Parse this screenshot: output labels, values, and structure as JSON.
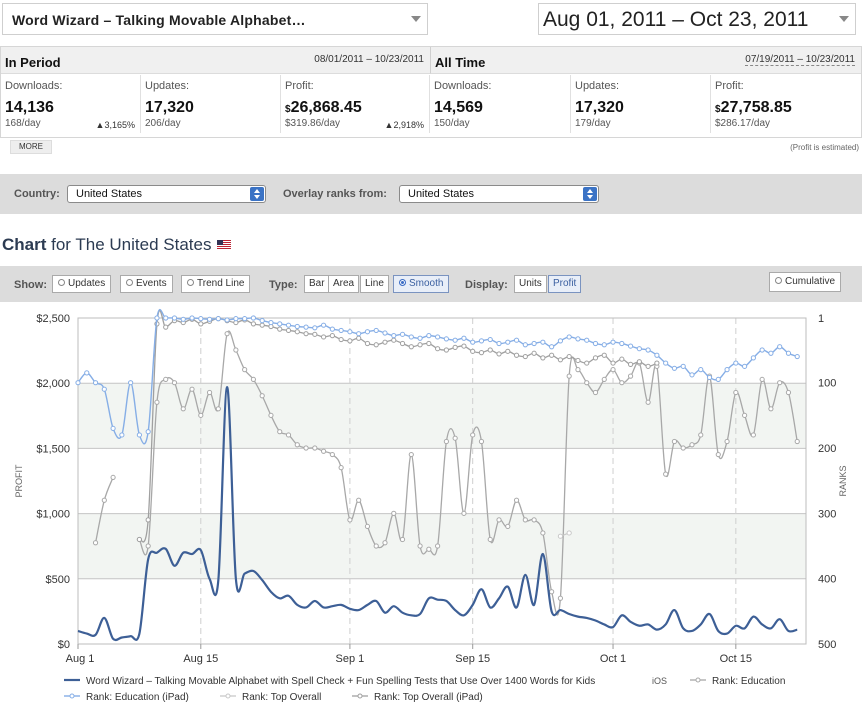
{
  "top": {
    "app_name": "Word Wizard – Talking Movable Alphabet…",
    "date_range": "Aug 01, 2011 – Oct 23, 2011"
  },
  "in_period": {
    "title": "In Period",
    "range": "08/01/2011 – 10/23/2011",
    "downloads": {
      "label": "Downloads:",
      "value": "14,136",
      "per_day": "168/day",
      "change": "3,165%"
    },
    "updates": {
      "label": "Updates:",
      "value": "17,320",
      "per_day": "206/day"
    },
    "profit": {
      "label": "Profit:",
      "currency": "$",
      "value": "26,868.45",
      "per_day": "$319.86/day",
      "change": "2,918%"
    }
  },
  "all_time": {
    "title": "All Time",
    "range": "07/19/2011 – 10/23/2011",
    "downloads": {
      "label": "Downloads:",
      "value": "14,569",
      "per_day": "150/day"
    },
    "updates": {
      "label": "Updates:",
      "value": "17,320",
      "per_day": "179/day"
    },
    "profit": {
      "label": "Profit:",
      "currency": "$",
      "value": "27,758.85",
      "per_day": "$286.17/day"
    }
  },
  "more_label": "MORE",
  "profit_note": "(Profit is estimated)",
  "filters": {
    "country_label": "Country:",
    "country_value": "United States",
    "overlay_label": "Overlay ranks from:",
    "overlay_value": "United States"
  },
  "chart_heading": {
    "bold": "Chart",
    "rest": " for The United States"
  },
  "toolbar": {
    "show_label": "Show:",
    "updates": "Updates",
    "events": "Events",
    "trend_line": "Trend Line",
    "type_label": "Type:",
    "bar": "Bar",
    "area": "Area",
    "line": "Line",
    "smooth": "Smooth",
    "display_label": "Display:",
    "units": "Units",
    "profit": "Profit",
    "cumulative": "Cumulative"
  },
  "colors": {
    "profit_line": "#3d5f96",
    "rank_education": "#a8a8a8",
    "rank_education_ipad": "#86aee6",
    "rank_top_overall": "#c8c8c8",
    "rank_top_overall_ipad": "#a0a0a0"
  },
  "chart_data": {
    "type": "line",
    "ylabel": "PROFIT",
    "y2label": "RANKS",
    "ylim": [
      0,
      2500
    ],
    "y2lim": [
      1,
      500
    ],
    "y2_inverted": true,
    "y_ticks": [
      "$0",
      "$500",
      "$1,000",
      "$1,500",
      "$2,000",
      "$2,500"
    ],
    "y2_ticks": [
      "1",
      "100",
      "200",
      "300",
      "400",
      "500"
    ],
    "x_ticks": [
      "Aug 1",
      "Aug 15",
      "Sep 1",
      "Sep 15",
      "Oct 1",
      "Oct 15"
    ],
    "x_tick_days": [
      1,
      15,
      32,
      46,
      62,
      76
    ],
    "x_range_days": [
      1,
      84
    ],
    "legend": {
      "profit": "Word Wizard – Talking Movable Alphabet with Spell Check + Fun Spelling Tests that Use Over 1400 Words for Kids",
      "profit_platform": "iOS",
      "rank_education": "Rank: Education",
      "rank_education_ipad": "Rank: Education (iPad)",
      "rank_top_overall": "Rank: Top Overall",
      "rank_top_overall_ipad": "Rank: Top Overall (iPad)"
    },
    "series": [
      {
        "key": "profit",
        "axis": "left",
        "x": [
          1,
          2,
          3,
          4,
          5,
          6,
          7,
          8,
          9,
          10,
          11,
          12,
          13,
          14,
          15,
          16,
          17,
          18,
          19,
          20,
          21,
          22,
          23,
          24,
          25,
          26,
          27,
          28,
          29,
          30,
          31,
          32,
          33,
          34,
          35,
          36,
          37,
          38,
          39,
          40,
          41,
          42,
          43,
          44,
          45,
          46,
          47,
          48,
          49,
          50,
          51,
          52,
          53,
          54,
          55,
          56,
          57,
          58,
          59,
          60,
          61,
          62,
          63,
          64,
          65,
          66,
          67,
          68,
          69,
          70,
          71,
          72,
          73,
          74,
          75,
          76,
          77,
          78,
          79,
          80,
          81,
          82,
          83
        ],
        "values": [
          100,
          80,
          70,
          200,
          40,
          50,
          60,
          80,
          650,
          700,
          730,
          600,
          700,
          690,
          720,
          500,
          490,
          1970,
          500,
          540,
          560,
          490,
          400,
          350,
          370,
          300,
          280,
          330,
          280,
          290,
          300,
          270,
          260,
          300,
          330,
          240,
          290,
          240,
          220,
          230,
          350,
          340,
          330,
          260,
          220,
          300,
          420,
          280,
          350,
          440,
          280,
          530,
          300,
          690,
          250,
          260,
          230,
          210,
          200,
          180,
          150,
          130,
          220,
          170,
          140,
          150,
          110,
          150,
          260,
          120,
          100,
          150,
          230,
          100,
          80,
          140,
          120,
          210,
          150,
          120,
          190,
          100,
          110
        ]
      },
      {
        "key": "rank_education_ipad",
        "axis": "right",
        "x": [
          1,
          2,
          3,
          4,
          5,
          6,
          7,
          8,
          9,
          10,
          11,
          12,
          13,
          14,
          15,
          16,
          17,
          18,
          19,
          20,
          21,
          22,
          23,
          24,
          25,
          26,
          27,
          28,
          29,
          30,
          31,
          32,
          33,
          34,
          35,
          36,
          37,
          38,
          39,
          40,
          41,
          42,
          43,
          44,
          45,
          46,
          47,
          48,
          49,
          50,
          51,
          52,
          53,
          54,
          55,
          56,
          57,
          58,
          59,
          60,
          61,
          62,
          63,
          64,
          65,
          66,
          67,
          68,
          69,
          70,
          71,
          72,
          73,
          74,
          75,
          76,
          77,
          78,
          79,
          80,
          81,
          82,
          83
        ],
        "values": [
          100,
          85,
          100,
          110,
          170,
          180,
          100,
          180,
          175,
          1,
          1,
          1,
          3,
          1,
          2,
          3,
          2,
          4,
          2,
          2,
          1,
          5,
          8,
          10,
          12,
          14,
          15,
          16,
          12,
          18,
          20,
          22,
          25,
          22,
          20,
          24,
          28,
          26,
          30,
          32,
          28,
          30,
          33,
          35,
          32,
          38,
          36,
          34,
          40,
          38,
          35,
          42,
          40,
          38,
          45,
          36,
          30,
          33,
          35,
          40,
          42,
          38,
          40,
          44,
          48,
          50,
          58,
          70,
          78,
          75,
          88,
          80,
          92,
          95,
          80,
          70,
          75,
          62,
          50,
          55,
          45,
          55,
          60
        ]
      },
      {
        "key": "rank_top_overall_ipad",
        "axis": "right",
        "x": [
          8,
          9,
          10,
          11,
          12,
          13,
          14,
          15,
          16,
          17,
          18,
          19,
          20,
          21,
          22,
          23,
          24,
          25,
          26,
          27,
          28,
          29,
          30,
          31,
          32,
          33,
          34,
          35,
          36,
          37,
          38,
          39,
          40,
          41,
          42,
          43,
          44,
          45,
          46,
          47,
          48,
          49,
          50,
          51,
          52,
          53,
          54,
          55,
          56,
          57,
          58,
          59,
          60,
          61,
          62,
          63,
          64,
          65,
          66,
          67
        ],
        "values": [
          340,
          310,
          10,
          15,
          5,
          8,
          3,
          10,
          6,
          2,
          5,
          8,
          4,
          10,
          12,
          14,
          18,
          20,
          22,
          25,
          26,
          30,
          28,
          34,
          36,
          32,
          40,
          42,
          38,
          35,
          40,
          45,
          42,
          40,
          48,
          50,
          46,
          44,
          52,
          54,
          50,
          56,
          52,
          58,
          60,
          55,
          62,
          58,
          65,
          60,
          66,
          70,
          62,
          58,
          70,
          64,
          72,
          68,
          75,
          70
        ]
      },
      {
        "key": "rank_education",
        "axis": "right",
        "x": [
          3,
          4,
          5,
          8,
          9,
          10,
          11,
          12,
          13,
          14,
          15,
          16,
          17,
          18,
          19,
          20,
          21,
          22,
          23,
          24,
          25,
          26,
          27,
          28,
          29,
          30,
          31,
          32,
          33,
          34,
          35,
          36,
          37,
          38,
          39,
          40,
          41,
          42,
          43,
          44,
          45,
          46,
          47,
          48,
          49,
          50,
          51,
          52,
          53,
          54,
          55,
          56,
          57,
          58,
          59,
          60,
          61,
          62,
          63,
          64,
          65,
          66,
          67,
          68,
          69,
          70,
          71,
          72,
          73,
          74,
          75,
          76,
          77,
          78,
          79,
          80,
          81,
          82,
          83
        ],
        "values": [
          345,
          280,
          245,
          340,
          350,
          130,
          95,
          100,
          140,
          110,
          150,
          115,
          140,
          25,
          50,
          80,
          95,
          120,
          150,
          175,
          180,
          195,
          200,
          200,
          205,
          210,
          230,
          310,
          280,
          320,
          350,
          345,
          300,
          340,
          210,
          350,
          355,
          350,
          190,
          185,
          300,
          180,
          190,
          340,
          310,
          320,
          280,
          310,
          310,
          330,
          420,
          430,
          90,
          80,
          100,
          115,
          95,
          80,
          100,
          90,
          70,
          130,
          75,
          240,
          190,
          200,
          195,
          180,
          90,
          210,
          190,
          115,
          150,
          180,
          95,
          140,
          100,
          115,
          190
        ]
      },
      {
        "key": "rank_top_overall",
        "axis": "right",
        "x": [
          56,
          57
        ],
        "values": [
          335,
          330
        ]
      }
    ]
  }
}
